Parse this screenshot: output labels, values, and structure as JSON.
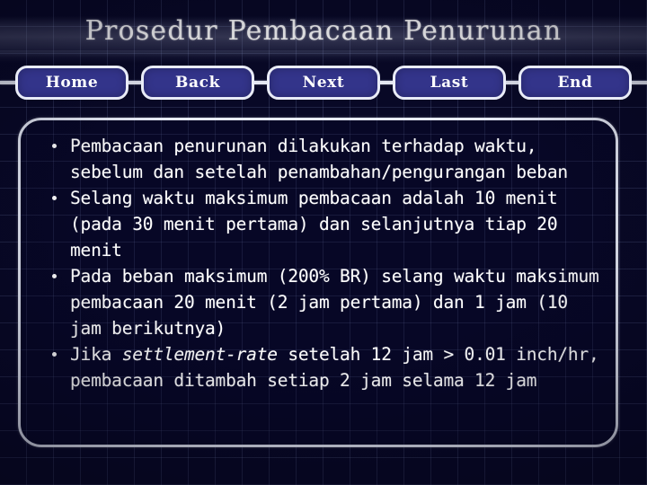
{
  "slide": {
    "title": "Prosedur Pembacaan Penurunan",
    "background_color": "#080826",
    "grid_line_color": "#96a5dc",
    "accent_color": "#33348a",
    "border_color": "#e6eaf6",
    "text_color": "#ffffff"
  },
  "nav": {
    "buttons": [
      {
        "label": "Home",
        "name": "home"
      },
      {
        "label": "Back",
        "name": "back"
      },
      {
        "label": "Next",
        "name": "next"
      },
      {
        "label": "Last",
        "name": "last"
      },
      {
        "label": "End",
        "name": "end"
      }
    ]
  },
  "content": {
    "bullets": [
      {
        "pre": "Pembacaan penurunan dilakukan terhadap waktu, sebelum dan setelah penambahan/pengurangan beban",
        "em": "",
        "post": ""
      },
      {
        "pre": "Selang waktu maksimum pembacaan adalah 10 menit (pada 30 menit pertama) dan selanjutnya tiap 20 menit",
        "em": "",
        "post": ""
      },
      {
        "pre": "Pada beban maksimum (200% BR) selang waktu maksimum pembacaan 20 menit (2 jam pertama) dan 1 jam (10 jam berikutnya)",
        "em": "",
        "post": ""
      },
      {
        "pre": "Jika ",
        "em": "settlement-rate",
        "post": " setelah 12 jam > 0.01 inch/hr, pembacaan ditambah setiap 2 jam selama 12 jam"
      }
    ]
  }
}
